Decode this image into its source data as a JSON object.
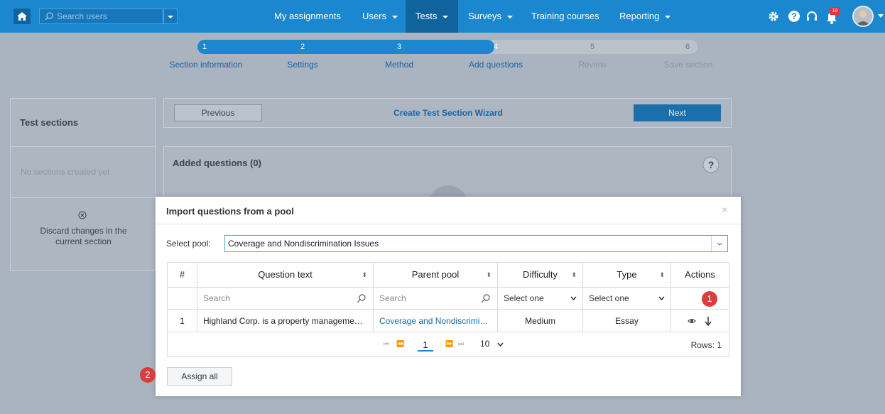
{
  "topbar": {
    "search_placeholder": "Search users",
    "nav": [
      {
        "label": "My assignments"
      },
      {
        "label": "Users"
      },
      {
        "label": "Tests"
      },
      {
        "label": "Surveys"
      },
      {
        "label": "Training courses"
      },
      {
        "label": "Reporting"
      }
    ],
    "notification_count": "10",
    "accent": "#1b87cf"
  },
  "wizard_steps": [
    {
      "num": "1",
      "label": "Section information"
    },
    {
      "num": "2",
      "label": "Settings"
    },
    {
      "num": "3",
      "label": "Method"
    },
    {
      "num": "4",
      "label": "Add questions"
    },
    {
      "num": "5",
      "label": "Review"
    },
    {
      "num": "6",
      "label": "Save section"
    }
  ],
  "sidebar": {
    "title": "Test sections",
    "empty_text": "No sections created yet",
    "discard_label": "Discard changes in the current section"
  },
  "wizard_bar": {
    "previous": "Previous",
    "title": "Create Test Section Wizard",
    "next": "Next"
  },
  "added_questions": {
    "title": "Added questions (0)",
    "help": "?"
  },
  "modal": {
    "title": "Import questions from a pool",
    "close": "×",
    "pool_label": "Select pool:",
    "pool_value": "Coverage and Nondiscrimination Issues",
    "columns": [
      "#",
      "Question text",
      "Parent pool",
      "Difficulty",
      "Type",
      "Actions"
    ],
    "filters": {
      "search1": "Search",
      "search2": "Search",
      "difficulty": "Select one",
      "type": "Select one"
    },
    "rows": [
      {
        "num": "1",
        "question": "Highland Corp. is a property manageme…",
        "pool": "Coverage and Nondiscrimi…",
        "difficulty": "Medium",
        "type": "Essay"
      }
    ],
    "pager": {
      "page": "1",
      "page_size": "10",
      "rows": "Rows: 1"
    },
    "assign_all": "Assign all",
    "marker1": "1",
    "marker2": "2"
  }
}
